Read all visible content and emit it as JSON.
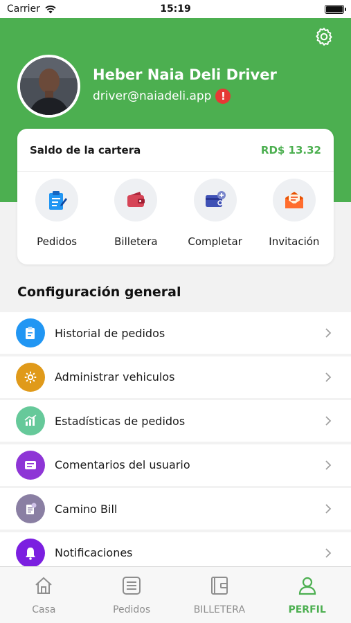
{
  "status_bar": {
    "carrier": "Carrier",
    "time": "15:19"
  },
  "profile": {
    "name": "Heber Naia Deli Driver",
    "email": "driver@naiadeli.app",
    "warning_mark": "!"
  },
  "wallet": {
    "balance_label": "Saldo de la cartera",
    "balance_value": "RD$ 13.32",
    "actions": [
      {
        "label": "Pedidos",
        "icon": "clipboard-icon"
      },
      {
        "label": "Billetera",
        "icon": "wallet-icon"
      },
      {
        "label": "Completar",
        "icon": "card-add-icon"
      },
      {
        "label": "Invitación",
        "icon": "envelope-icon"
      }
    ]
  },
  "section_title": "Configuración general",
  "menu": [
    {
      "label": "Historial de pedidos",
      "icon": "order-history-icon",
      "color": "#2196f3"
    },
    {
      "label": "Administrar vehiculos",
      "icon": "gear-icon",
      "color": "#e09a1a"
    },
    {
      "label": "Estadísticas de pedidos",
      "icon": "chart-icon",
      "color": "#66c99a"
    },
    {
      "label": "Comentarios del usuario",
      "icon": "comment-icon",
      "color": "#8e35d6"
    },
    {
      "label": "Camino Bill",
      "icon": "bill-icon",
      "color": "#8a7fa3"
    },
    {
      "label": "Notificaciones",
      "icon": "bell-icon",
      "color": "#7b1fe0"
    }
  ],
  "tabs": [
    {
      "label": "Casa",
      "icon": "home-icon",
      "active": false
    },
    {
      "label": "Pedidos",
      "icon": "list-icon",
      "active": false
    },
    {
      "label": "BILLETERA",
      "icon": "wallet-outline-icon",
      "active": false
    },
    {
      "label": "PERFIL",
      "icon": "person-icon",
      "active": true
    }
  ],
  "colors": {
    "brand_green": "#4caf50",
    "alert_red": "#e53935"
  }
}
